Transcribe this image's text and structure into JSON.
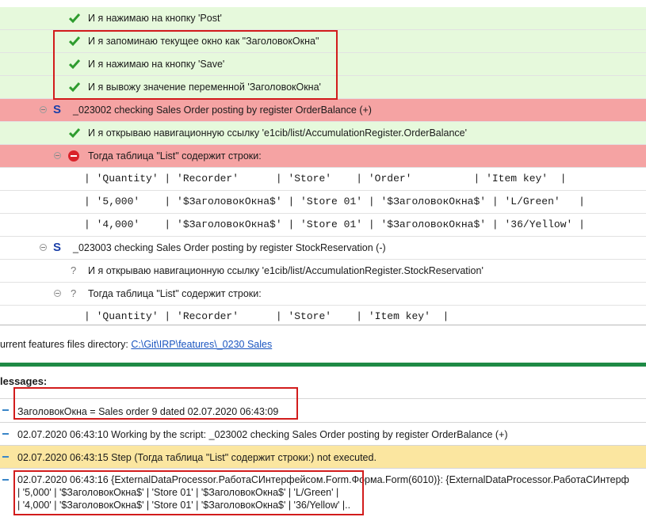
{
  "tree": {
    "rows": [
      {
        "status": "passed",
        "text": "И я нажимаю на кнопку 'Post'"
      },
      {
        "status": "passed",
        "text": "И я запоминаю текущее окно как \"ЗаголовокОкна\""
      },
      {
        "status": "passed",
        "text": "И я нажимаю на кнопку 'Save'"
      },
      {
        "status": "passed",
        "text": "И я вывожу значение переменной 'ЗаголовокОкна'"
      },
      {
        "status": "scenario-failed",
        "prefix": "S",
        "text": "_023002 checking Sales Order posting by register OrderBalance (+)"
      },
      {
        "status": "passed",
        "text": "И я открываю навигационную ссылку 'e1cib/list/AccumulationRegister.OrderBalance'"
      },
      {
        "status": "failed",
        "text": "Тогда таблица \"List\" содержит строки:"
      },
      {
        "status": "table",
        "text": "| 'Quantity' | 'Recorder'      | 'Store'    | 'Order'          | 'Item key'  |"
      },
      {
        "status": "table",
        "text": "| '5,000'    | '$ЗаголовокОкна$' | 'Store 01' | '$ЗаголовокОкна$' | 'L/Green'   |"
      },
      {
        "status": "table",
        "text": "| '4,000'    | '$ЗаголовокОкна$' | 'Store 01' | '$ЗаголовокОкна$' | '36/Yellow' |"
      },
      {
        "status": "scenario",
        "prefix": "S",
        "text": "_023003 checking Sales Order posting by register StockReservation (-)"
      },
      {
        "status": "unknown",
        "text": "И я открываю навигационную ссылку 'e1cib/list/AccumulationRegister.StockReservation'"
      },
      {
        "status": "unknown",
        "text": "Тогда таблица \"List\" содержит строки:"
      },
      {
        "status": "table",
        "text": "| 'Quantity' | 'Recorder'      | 'Store'    | 'Item key'  |"
      }
    ]
  },
  "features_dir": {
    "label": "urrent features files directory:",
    "path": "C:\\Git\\IRP\\features\\_0230 Sales"
  },
  "messages": {
    "title": "lessages:",
    "items": [
      {
        "text": "ЗаголовокОкна = Sales order 9 dated 02.07.2020 06:43:09"
      },
      {
        "text": "02.07.2020 06:43:10 Working by the script: _023002 checking Sales Order posting by register OrderBalance (+)"
      },
      {
        "text": "02.07.2020 06:43:15 Step (Тогда таблица \"List\" содержит строки:) not executed."
      },
      {
        "text": "02.07.2020 06:43:16 {ExternalDataProcessor.РаботаСИнтерфейсом.Form.Форма.Form(6010)}: {ExternalDataProcessor.РаботаСИнтерф",
        "line2": "| '5,000' | '$ЗаголовокОкна$' | 'Store 01' | '$ЗаголовокОкна$' | 'L/Green' |",
        "line3": "| '4,000' | '$ЗаголовокОкна$' | 'Store 01' | '$ЗаголовокОкна$' | '36/Yellow' |.."
      }
    ]
  }
}
